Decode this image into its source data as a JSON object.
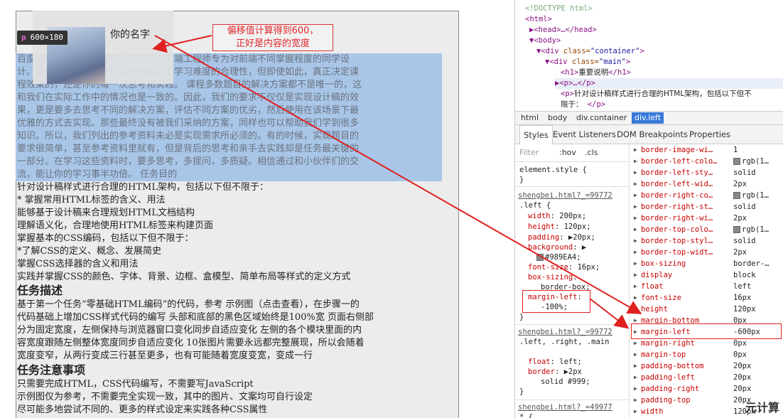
{
  "page": {
    "profile_name": "你的名字",
    "size_badge": {
      "tag": "p",
      "size": "600×180"
    },
    "callout": [
      "偏移值计算得到600，",
      "正好是内容的宽度"
    ],
    "highlight_lines": [
      "百度前端技术学院的课程大多由百度前端工程师专为对前端不同掌握程度的同学设",
      "计。我们力求提高课程内容的质量以及学习难度的合理性，但即使如此，真正决定课",
      "程效果的，还是你的每一次思考和实践。 课程多数题目的解决方案都不是唯一的，这",
      "和我们在实际工作中的情况也是一致的。因此，我们的要求不仅仅是实现设计稿的效",
      "果，更是要多去思考不同的解决方案，评估不同方案的优劣，然后使用在该场景下最",
      "优雅的方式去实现。那些最终没有被我们采纳的方案，同样也可以帮助我们学到很多",
      "知识。所以，我们列出的参考资料未必是实现需求所必须的。有的时候，实现题目的",
      "要求很简单，甚至参考资料里就有，但是背后的思考和亲手去实践却是任务最关键的",
      "一部分。在学习这些资料时，要多思考，多提问，多质疑。相信通过和小伙伴们的交",
      "流，能让你的学习事半功倍。 任务目的"
    ],
    "body_lines": [
      "针对设计稿样式进行合理的HTML架构，包括以下但不限于：",
      "* 掌握常用HTML标签的含义、用法",
      "能够基于设计稿来合理规划HTML文档结构",
      "理解语义化，合理地使用HTML标签来构建页面",
      "掌握基本的CSS编码，包括以下但不限于：",
      "*了解CSS的定义、概念、发展简史",
      "掌握CSS选择器的含义和用法",
      "实践并掌握CSS的颜色、字体、背景、边框、盒模型、简单布局等样式的定义方式"
    ],
    "heading_task": "任务描述",
    "task_lines": [
      "基于第一个任务“零基础HTML编码”的代码，参考 示例图（点击查看），在步骤一的",
      "代码基础上增加CSS样式代码的编写 头部和底部的黑色区域始终是100%宽 页面右侧部",
      "分为固定宽度，左侧保持与浏览器窗口变化同步自适应变化 左侧的各个模块里面的内",
      "容宽度跟随左侧整体宽度同步自适应变化 10张图片需要永远都完整展现，所以会随着",
      "宽度变窄，从两行变成三行甚至更多，也有可能随着宽度变宽，变成一行"
    ],
    "heading_notes": "任务注意事项",
    "note_lines": [
      "只需要完成HTML，CSS代码编写，不需要写JavaScript",
      "示例图仅为参考，不需要完全实现一致，其中的图片、文案均可自行设定",
      "尽可能多地尝试不同的、更多的样式设定来实践各种CSS属性"
    ]
  },
  "devtools": {
    "dom": {
      "doctype": "<!DOCTYPE html>",
      "html_open": "<html>",
      "head": "<head>…</head>",
      "body_open": "<body>",
      "container_tag": "<div ",
      "container_attr": "class=",
      "container_val": "\"container\"",
      "container_end": ">",
      "main_tag": "<div ",
      "main_attr": "class=",
      "main_val": "\"main\"",
      "main_end": ">",
      "h1_open": "<h1>",
      "h1_text": "重要说明",
      "h1_close": "</h1>",
      "p_collapsed": "<p>…</p>",
      "p2_open": "<p>",
      "p2_text": "针对设计稿样式进行合理的HTML架构，包括以下但不",
      "p2_text2": "限于：",
      "p2_close": "</p>"
    },
    "crumbs": [
      "html",
      "body",
      "div.container",
      "div.left"
    ],
    "tabs": [
      "Styles",
      "Event Listeners",
      "DOM Breakpoints",
      "Properties"
    ],
    "filter": {
      "placeholder": "Filter",
      "hov": ":hov",
      "cls": ".cls"
    },
    "element_style": {
      "selector": "element.style {",
      "close": "}"
    },
    "rule1": {
      "source": "shengbei.html?_=99772",
      "selector": ".left {",
      "props": [
        [
          "width",
          "200px;"
        ],
        [
          "height",
          "120px;"
        ],
        [
          "padding",
          "▶20px;"
        ],
        [
          "background",
          "▶"
        ],
        [
          "",
          "#989EA4;"
        ],
        [
          "font-size",
          "16px;"
        ],
        [
          "box-sizing",
          ""
        ],
        [
          "",
          "border-box;"
        ],
        [
          "margin-left",
          ""
        ],
        [
          "",
          "-100%;"
        ]
      ],
      "close": "}"
    },
    "rule2": {
      "source": "shengbei.html?_=99772",
      "selector": ".left, .right, .main",
      "props": [
        [
          "float",
          "left;"
        ],
        [
          "border",
          "▶2px"
        ],
        [
          "",
          "solid #999;"
        ]
      ],
      "close": "}"
    },
    "rule3": {
      "source": "shengbei.html?_=49977",
      "selector": "* {"
    },
    "computed": [
      [
        "border-image-wi…",
        "1"
      ],
      [
        "border-left-colo…",
        "rgb(1…"
      ],
      [
        "border-left-sty…",
        "solid"
      ],
      [
        "border-left-wid…",
        "2px"
      ],
      [
        "border-right-co…",
        "rgb(1…"
      ],
      [
        "border-right-st…",
        "solid"
      ],
      [
        "border-right-wi…",
        "2px"
      ],
      [
        "border-top-colo…",
        "rgb(1…"
      ],
      [
        "border-top-styl…",
        "solid"
      ],
      [
        "border-top-widt…",
        "2px"
      ],
      [
        "box-sizing",
        "border-…"
      ],
      [
        "display",
        "block"
      ],
      [
        "float",
        "left"
      ],
      [
        "font-size",
        "16px"
      ],
      [
        "height",
        "120px"
      ],
      [
        "margin-bottom",
        "0px"
      ],
      [
        "margin-left",
        "-600px"
      ],
      [
        "margin-right",
        "0px"
      ],
      [
        "margin-top",
        "0px"
      ],
      [
        "padding-bottom",
        "20px"
      ],
      [
        "padding-left",
        "20px"
      ],
      [
        "padding-right",
        "20px"
      ],
      [
        "padding-top",
        "20px"
      ],
      [
        "width",
        "120px"
      ]
    ]
  },
  "watermark": "元计算",
  "colors": {
    "highlight": "#a9c6e8",
    "annotation_red": "#e02020",
    "selected_crumb": "#3879d9"
  }
}
